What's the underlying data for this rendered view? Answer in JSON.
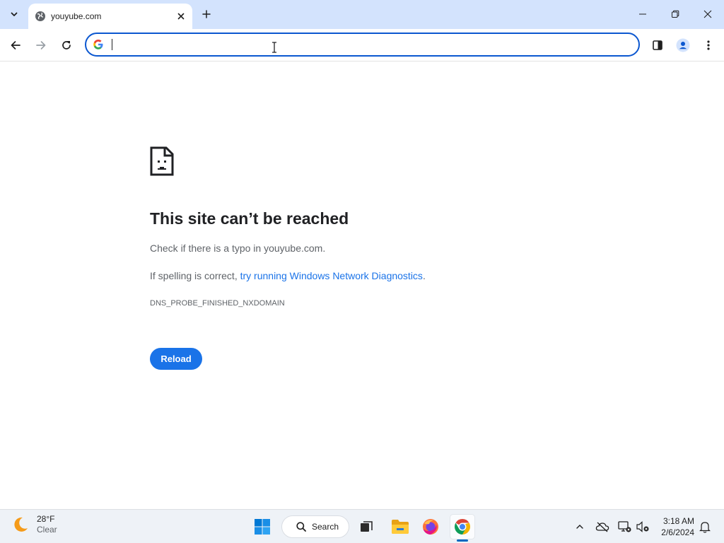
{
  "browser": {
    "tab": {
      "title": "youyube.com",
      "favicon": "globe-icon"
    },
    "omnibox": {
      "value": "",
      "placeholder": ""
    },
    "colors": {
      "tabstrip": "#d3e3fd",
      "accent": "#0b57d0"
    }
  },
  "error_page": {
    "title": "This site can’t be reached",
    "line1": "Check if there is a typo in youyube.com.",
    "line2_prefix": "If spelling is correct, ",
    "line2_link": "try running Windows Network Diagnostics",
    "line2_suffix": ".",
    "error_code": "DNS_PROBE_FINISHED_NXDOMAIN",
    "reload_label": "Reload",
    "colors": {
      "link": "#1a73e8",
      "button": "#1a73e8"
    }
  },
  "taskbar": {
    "weather": {
      "temp": "28°F",
      "condition": "Clear",
      "icon": "moon-icon"
    },
    "search_label": "Search",
    "apps": [
      "start-icon",
      "search-icon",
      "task-view-icon",
      "file-explorer-icon",
      "firefox-icon",
      "chrome-icon"
    ],
    "clock": {
      "time": "3:18 AM",
      "date": "2/6/2024"
    }
  }
}
